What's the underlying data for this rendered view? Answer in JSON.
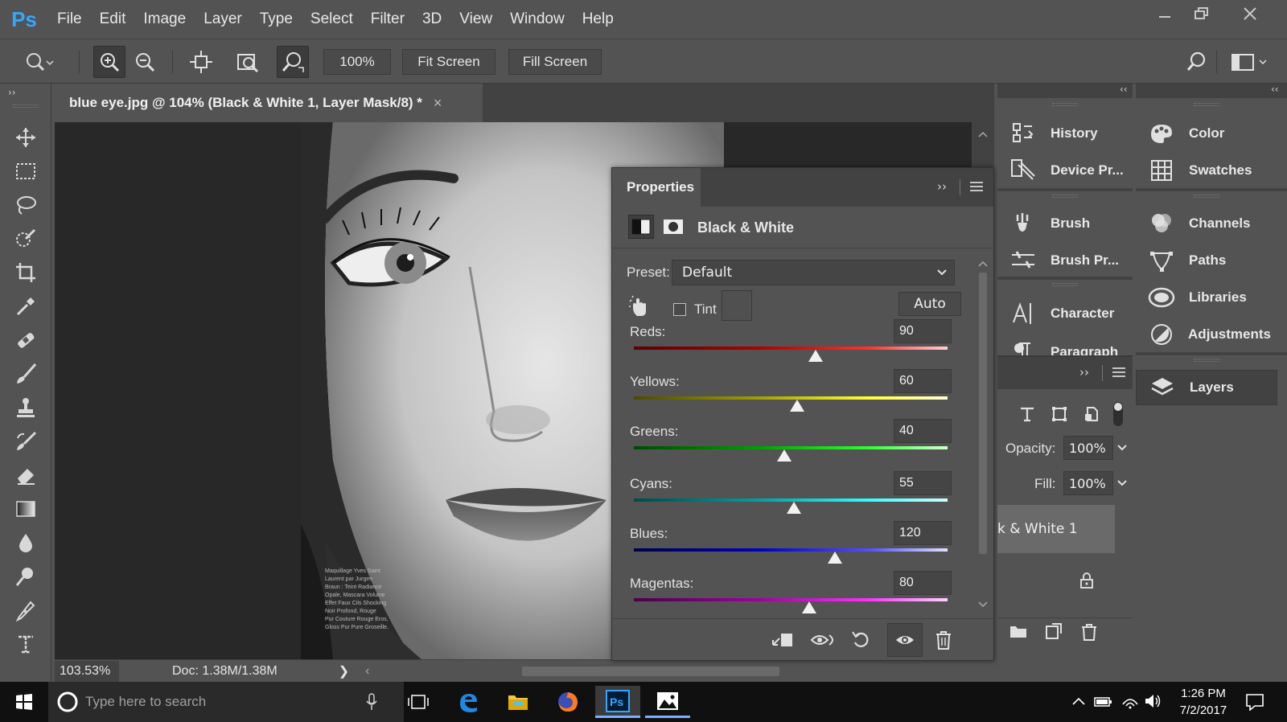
{
  "app": {
    "logo": "Ps",
    "menu": [
      "File",
      "Edit",
      "Image",
      "Layer",
      "Type",
      "Select",
      "Filter",
      "3D",
      "View",
      "Window",
      "Help"
    ]
  },
  "options_bar": {
    "zoom_value": "100%",
    "fit_screen": "Fit Screen",
    "fill_screen": "Fill Screen"
  },
  "document": {
    "tab_title": "blue eye.jpg @ 104% (Black & White 1, Layer Mask/8) *",
    "tab_close": "×",
    "zoom": "103.53%",
    "doc_info": "Doc: 1.38M/1.38M",
    "photo_text_lines": [
      "Maquillage Yves Saint",
      "Laurent par Jurgen",
      "Braun : Teint Radiance",
      "Opale, Mascara Volume",
      "Effet Faux Cils Shocking",
      "Noir Profond, Rouge",
      "Pur Couture Rouge Eros,",
      "Gloss Pur Pure Groseille."
    ]
  },
  "properties": {
    "tab_label": "Properties",
    "title": "Black & White",
    "preset_label": "Preset:",
    "preset_value": "Default",
    "tint_label": "Tint",
    "tint_checked": false,
    "auto_label": "Auto",
    "sliders": [
      {
        "label": "Reds:",
        "value": "90",
        "range": [
          -200,
          300
        ]
      },
      {
        "label": "Yellows:",
        "value": "60",
        "range": [
          -200,
          300
        ]
      },
      {
        "label": "Greens:",
        "value": "40",
        "range": [
          -200,
          300
        ]
      },
      {
        "label": "Cyans:",
        "value": "55",
        "range": [
          -200,
          300
        ]
      },
      {
        "label": "Blues:",
        "value": "120",
        "range": [
          -200,
          300
        ]
      },
      {
        "label": "Magentas:",
        "value": "80",
        "range": [
          -200,
          300
        ]
      }
    ]
  },
  "dock": {
    "col1": [
      {
        "label": "History",
        "icon": "history-icon"
      },
      {
        "label": "Device Pr...",
        "icon": "device-preview-icon"
      },
      {
        "label": "Brush",
        "icon": "brush-icon"
      },
      {
        "label": "Brush Pr...",
        "icon": "brush-presets-icon"
      },
      {
        "label": "Character",
        "icon": "character-icon"
      },
      {
        "label": "Paragraph",
        "icon": "paragraph-icon"
      }
    ],
    "col2": [
      {
        "label": "Color",
        "icon": "color-icon"
      },
      {
        "label": "Swatches",
        "icon": "swatches-icon"
      },
      {
        "label": "Channels",
        "icon": "channels-icon"
      },
      {
        "label": "Paths",
        "icon": "paths-icon"
      },
      {
        "label": "Libraries",
        "icon": "libraries-icon"
      },
      {
        "label": "Adjustments",
        "icon": "adjustments-icon"
      },
      {
        "label": "Layers",
        "icon": "layers-icon"
      }
    ]
  },
  "layers": {
    "opacity_label": "Opacity:",
    "opacity_value": "100%",
    "fill_label": "Fill:",
    "fill_value": "100%",
    "layer_name": "k & White 1"
  },
  "taskbar": {
    "search_placeholder": "Type here to search",
    "time": "1:26 PM",
    "date": "7/2/2017"
  },
  "colors": {
    "accent_ps": "#31a8ff",
    "panel_bg": "#535353",
    "canvas_bg": "#282828"
  }
}
